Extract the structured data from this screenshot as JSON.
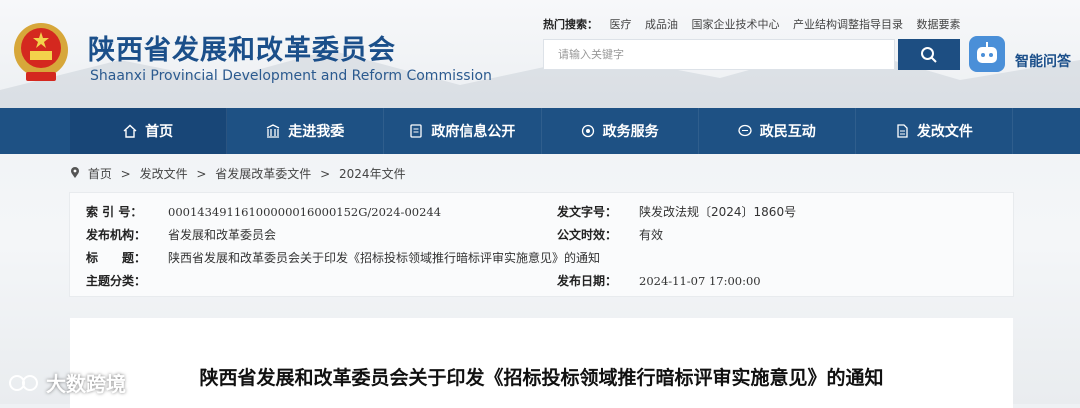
{
  "header": {
    "title_cn": "陕西省发展和改革委员会",
    "title_en": "Shaanxi Provincial Development and Reform Commission"
  },
  "hot_search": {
    "label": "热门搜索：",
    "items": [
      "医疗",
      "成品油",
      "国家企业技术中心",
      "产业结构调整指导目录",
      "数据要素"
    ]
  },
  "search": {
    "placeholder": "请输入关键字",
    "icon": "search-icon"
  },
  "assistant": {
    "label": "智能问答",
    "icon": "robot-icon"
  },
  "nav": {
    "items": [
      {
        "label": "首页",
        "icon": "home-icon"
      },
      {
        "label": "走进我委",
        "icon": "building-icon"
      },
      {
        "label": "政府信息公开",
        "icon": "document-icon"
      },
      {
        "label": "政务服务",
        "icon": "service-icon"
      },
      {
        "label": "政民互动",
        "icon": "chat-icon"
      },
      {
        "label": "发改文件",
        "icon": "file-icon"
      }
    ]
  },
  "breadcrumb": {
    "items": [
      "首页",
      "发改文件",
      "省发展改革委文件",
      "2024年文件"
    ],
    "separator": ">"
  },
  "info": {
    "index_label": "索 引 号：",
    "index_value": "00014349116100000016000152G/2024-00244",
    "doc_no_label": "发文字号：",
    "doc_no_value": "陕发改法规〔2024〕1860号",
    "issuer_label": "发布机构：",
    "issuer_value": "省发展和改革委员会",
    "validity_label": "公文时效：",
    "validity_value": "有效",
    "title_label": "标　　题：",
    "title_value": "陕西省发展和改革委员会关于印发《招标投标领域推行暗标评审实施意见》的通知",
    "category_label": "主题分类：",
    "category_value": "",
    "date_label": "发布日期：",
    "date_value": "2024-11-07 17:00:00"
  },
  "document": {
    "title": "陕西省发展和改革委员会关于印发《招标投标领域推行暗标评审实施意见》的通知"
  },
  "watermark": {
    "text": "大数跨境"
  },
  "colors": {
    "nav_bg": "#1e5184",
    "brand": "#1b4f8a",
    "search_btn": "#1d4e82"
  }
}
